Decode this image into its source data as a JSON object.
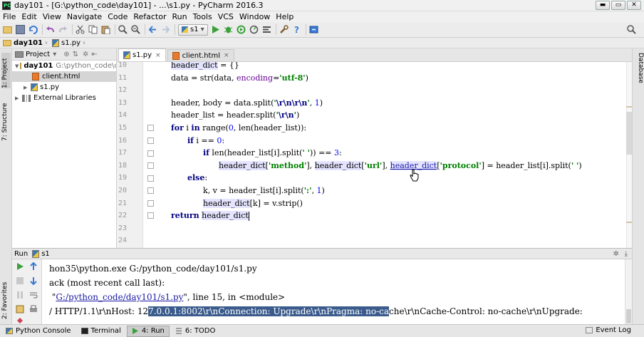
{
  "window": {
    "title": "day101 - [G:\\python_code\\day101] - ...\\s1.py - PyCharm 2016.3",
    "minimize": "▬",
    "maximize": "▭",
    "close": "✕"
  },
  "menu": [
    "File",
    "Edit",
    "View",
    "Navigate",
    "Code",
    "Refactor",
    "Run",
    "Tools",
    "VCS",
    "Window",
    "Help"
  ],
  "toolbar": {
    "run_config": "s1",
    "run_config_arrow": "▾"
  },
  "breadcrumb": {
    "project": "day101",
    "file": "s1.py"
  },
  "left_stripe": {
    "project_tab": "1: Project",
    "structure_tab": "7: Structure",
    "favorites_tab": "2: Favorites"
  },
  "right_stripe": {
    "database_tab": "Database"
  },
  "project_panel": {
    "title": "Project",
    "title_arrow": "▾",
    "tree": [
      {
        "label": "day101",
        "path": "G:\\python_code\\day",
        "type": "folder",
        "expanded": true
      },
      {
        "label": "client.html",
        "type": "html",
        "selected": true
      },
      {
        "label": "s1.py",
        "type": "py"
      },
      {
        "label": "External Libraries",
        "type": "lib"
      }
    ]
  },
  "editor": {
    "tabs": [
      {
        "label": "s1.py",
        "active": true,
        "close": "×"
      },
      {
        "label": "client.html",
        "active": false,
        "close": "×"
      }
    ],
    "line_numbers": [
      "10",
      "11",
      "12",
      "13",
      "14",
      "15",
      "16",
      "17",
      "18",
      "19",
      "20",
      "21",
      "22",
      "23",
      "24"
    ]
  },
  "run_panel": {
    "title": "Run",
    "config": "s1",
    "console": {
      "line1": "hon35\\python.exe G:/python_code/day101/s1.py",
      "line2": "ack (most recent call last):",
      "line3_pre": " \"",
      "line3_link": "G:/python_code/day101/s1.py",
      "line3_post": "\", line 15, in <module>",
      "line4_pre": "/ HTTP/1.1\\r\\nHost: 12",
      "line4_sel": "7.0.0.1:8002\\r\\nConnection: Upgrade\\r\\nPragma: no-ca",
      "line4_post": "che\\r\\nCache-Control: no-cache\\r\\nUpgrade:"
    }
  },
  "bottom_bar": {
    "python_console": "Python Console",
    "terminal": "Terminal",
    "run": "4: Run",
    "todo": "6: TODO",
    "event_log": "Event Log"
  },
  "colors": {
    "keyword": "#000080",
    "string": "#008000",
    "number": "#0000ff",
    "param": "#660099",
    "identifier_highlight": "#e4e4ff",
    "console_selection": "#3a5b8c"
  }
}
